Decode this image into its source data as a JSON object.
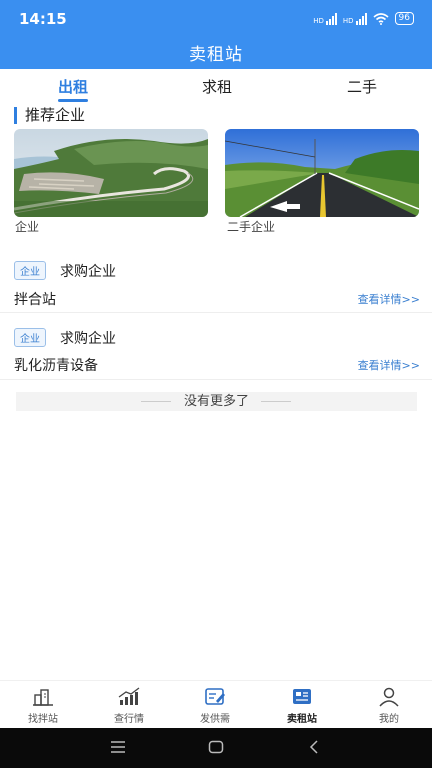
{
  "status": {
    "time": "14:15",
    "battery": "96",
    "signal1": "HD",
    "signal2": "HD"
  },
  "header": {
    "title": "卖租站"
  },
  "tabs": [
    {
      "label": "出租",
      "active": true
    },
    {
      "label": "求租",
      "active": false
    },
    {
      "label": "二手",
      "active": false
    }
  ],
  "section": {
    "title": "推荐企业"
  },
  "cards": [
    {
      "label": "企业",
      "image": "coastal-highway-photo"
    },
    {
      "label": "二手企业",
      "image": "country-road-photo"
    }
  ],
  "items": [
    {
      "tag": "企业",
      "title": "求购企业",
      "name": "拌合站",
      "link": "查看详情>>"
    },
    {
      "tag": "企业",
      "title": "求购企业",
      "name": "乳化沥青设备",
      "link": "查看详情>>"
    }
  ],
  "no_more": "没有更多了",
  "bottom_nav": [
    {
      "label": "找拌站",
      "icon": "building-icon"
    },
    {
      "label": "查行情",
      "icon": "chart-icon"
    },
    {
      "label": "发供需",
      "icon": "edit-icon"
    },
    {
      "label": "卖租站",
      "icon": "newspaper-icon",
      "active": true
    },
    {
      "label": "我的",
      "icon": "user-icon"
    }
  ],
  "colors": {
    "primary": "#3a8ff0",
    "accent": "#2f7fe0"
  }
}
